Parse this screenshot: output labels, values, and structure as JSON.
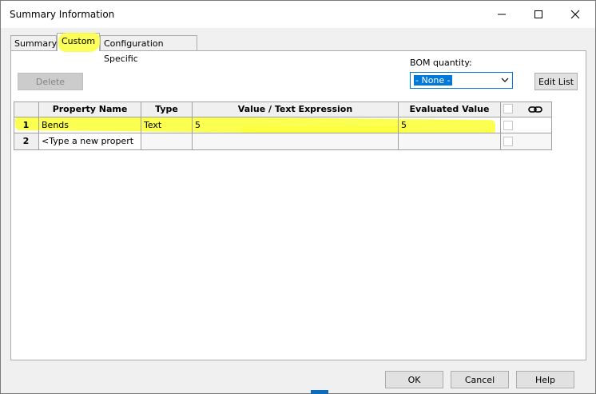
{
  "window": {
    "title": "Summary Information"
  },
  "tabs": [
    {
      "label": "Summary"
    },
    {
      "label": "Custom"
    },
    {
      "label": "Configuration Specific"
    }
  ],
  "toolbar": {
    "delete_label": "Delete",
    "bom_label": "BOM quantity:",
    "bom_selected": "- None -",
    "edit_list_label": "Edit List"
  },
  "grid": {
    "columns": [
      "Property Name",
      "Type",
      "Value / Text Expression",
      "Evaluated Value"
    ],
    "rows": [
      {
        "num": "1",
        "name": "Bends",
        "type": "Text",
        "value": "5",
        "evaluated": "5"
      },
      {
        "num": "2",
        "name": "<Type a new propert",
        "type": "",
        "value": "",
        "evaluated": ""
      }
    ]
  },
  "footer": {
    "ok_label": "OK",
    "cancel_label": "Cancel",
    "help_label": "Help"
  },
  "colors": {
    "highlight": "#fbff3d",
    "accent": "#0078d7"
  }
}
